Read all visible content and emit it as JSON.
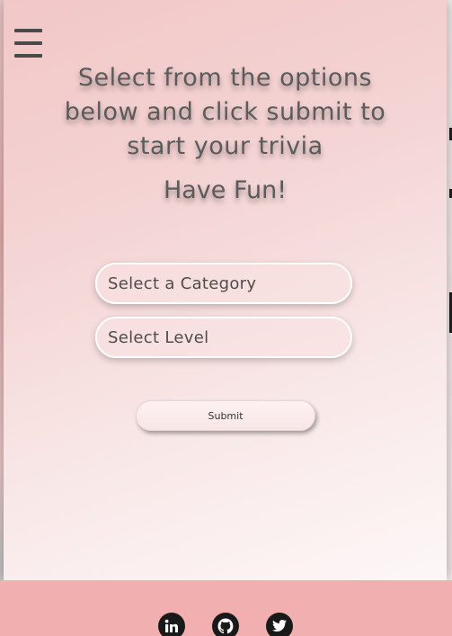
{
  "menu": {
    "icon": "hamburger-menu-icon"
  },
  "header": {
    "instructions": "Select from the options below and click submit to start your trivia",
    "tagline": "Have Fun!"
  },
  "form": {
    "category_label": "Select a Category",
    "level_label": "Select Level",
    "submit_label": "Submit"
  },
  "footer": {
    "social_icons": [
      "linkedin-icon",
      "github-icon",
      "twitter-icon"
    ]
  },
  "colors": {
    "panel_gradient_start": "#f2c7c7",
    "panel_gradient_end": "#fdf7f7",
    "footer_background": "#f1afaf",
    "text": "#5b5b5b",
    "icon": "#1a1a1a"
  }
}
